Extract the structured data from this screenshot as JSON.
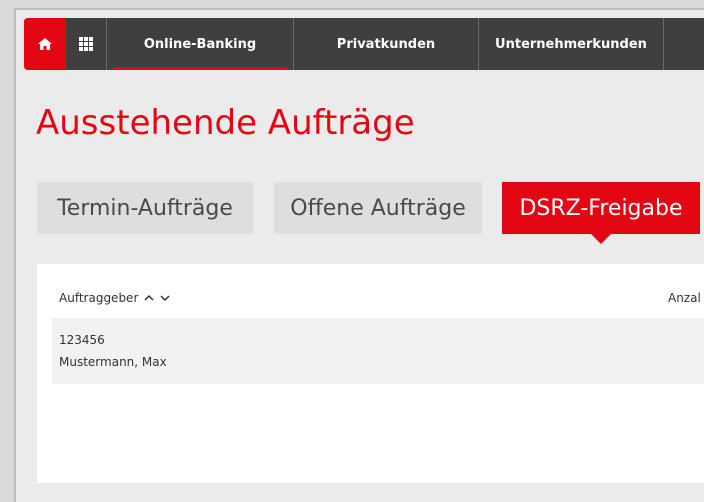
{
  "nav": {
    "items": [
      "Online-Banking",
      "Privatkunden",
      "Unternehmerkunden"
    ]
  },
  "page": {
    "title": "Ausstehende Aufträge"
  },
  "tabs": [
    "Termin-Aufträge",
    "Offene Aufträge",
    "DSRZ-Freigabe"
  ],
  "table": {
    "columns": [
      "Auftraggeber",
      "Anzal"
    ],
    "rows": [
      {
        "id": "123456",
        "name": "Mustermann, Max"
      }
    ]
  },
  "colors": {
    "accent": "#e30613",
    "nav_bg": "#3f3f3f"
  }
}
